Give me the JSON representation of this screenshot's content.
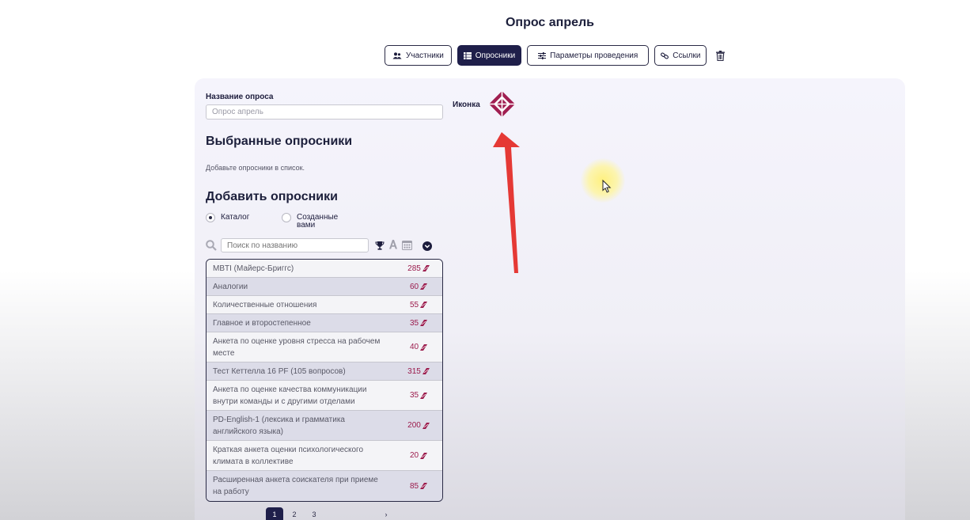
{
  "title": "Опрос апрель",
  "tabs": [
    {
      "label": "Участники",
      "icon": "users-icon"
    },
    {
      "label": "Опросники",
      "icon": "list-icon",
      "active": true
    },
    {
      "label": "Параметры проведения",
      "icon": "sliders-icon"
    },
    {
      "label": "Ссылки",
      "icon": "link-icon"
    }
  ],
  "form": {
    "name_label": "Название опроса",
    "name_value": "Опрос апрель",
    "icon_label": "Иконка"
  },
  "selected": {
    "title": "Выбранные опросники",
    "hint": "Добавьте опросники в список."
  },
  "add": {
    "title": "Добавить опросники",
    "radio_catalog": "Каталог",
    "radio_created_line1": "Созданные",
    "radio_created_line2": "вами",
    "search_placeholder": "Поиск по названию"
  },
  "surveys": [
    {
      "name": "MBTI (Майерс-Бриггс)",
      "price": "285"
    },
    {
      "name": "Аналогии",
      "price": "60"
    },
    {
      "name": "Количественные отношения",
      "price": "55"
    },
    {
      "name": "Главное и второстепенное",
      "price": "35"
    },
    {
      "name": "Анкета по оценке уровня стресса на рабочем месте",
      "price": "40"
    },
    {
      "name": "Тест Кеттелла 16 PF (105 вопросов)",
      "price": "315"
    },
    {
      "name": "Анкета по оценке качества коммуникации внутри команды и с другими отделами",
      "price": "35"
    },
    {
      "name": "PD-English-1 (лексика и грамматика английского языка)",
      "price": "200"
    },
    {
      "name": "Краткая анкета оценки психологического климата в коллективе",
      "price": "20"
    },
    {
      "name": "Расширенная анкета соискателя при приеме на работу",
      "price": "85"
    }
  ],
  "pagination": {
    "pages": [
      "1",
      "2",
      "3"
    ],
    "next": "›",
    "current": "1"
  },
  "colors": {
    "primary": "#1f1f4a",
    "accent": "#9b1b4c",
    "arrow": "#e53935"
  }
}
